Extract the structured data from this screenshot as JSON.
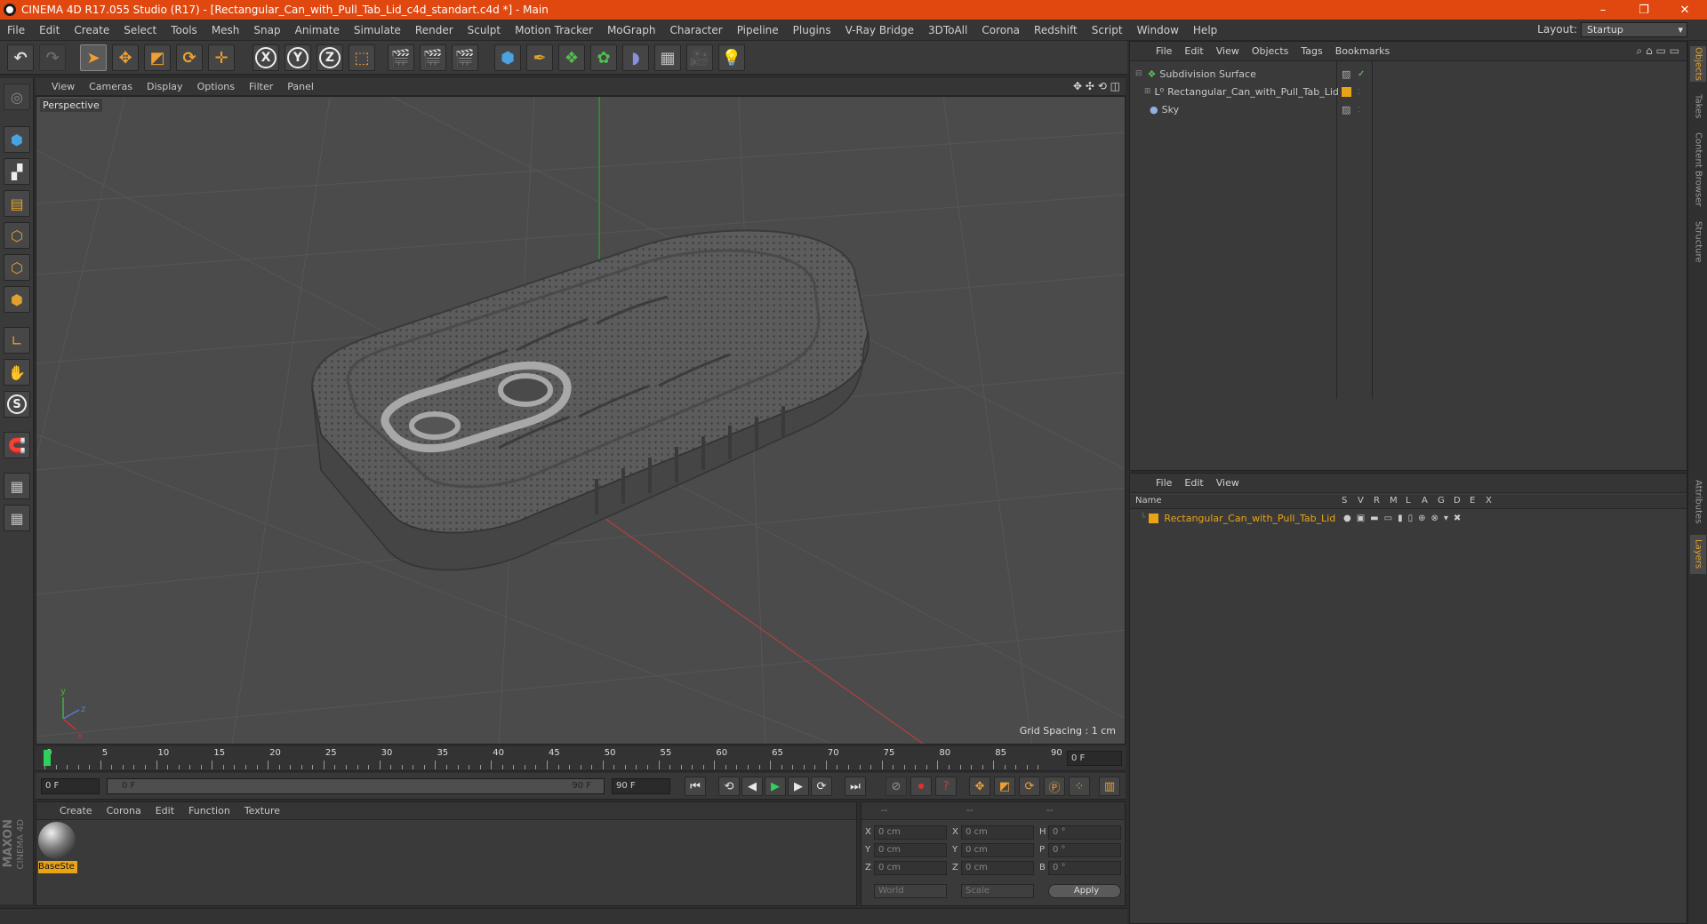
{
  "window": {
    "title": "CINEMA 4D R17.055 Studio (R17) - [Rectangular_Can_with_Pull_Tab_Lid_c4d_standart.c4d *] - Main",
    "minimize": "–",
    "restore": "❐",
    "close": "✕"
  },
  "menu": [
    "File",
    "Edit",
    "Create",
    "Select",
    "Tools",
    "Mesh",
    "Snap",
    "Animate",
    "Simulate",
    "Render",
    "Sculpt",
    "Motion Tracker",
    "MoGraph",
    "Character",
    "Pipeline",
    "Plugins",
    "V-Ray Bridge",
    "3DToAll",
    "Corona",
    "Redshift",
    "Script",
    "Window",
    "Help"
  ],
  "layout": {
    "label": "Layout:",
    "value": "Startup"
  },
  "toolbar": {
    "axis_x": "X",
    "axis_y": "Y",
    "axis_z": "Z"
  },
  "lefttools": {
    "snap_s": "S"
  },
  "viewport": {
    "menu": [
      "View",
      "Cameras",
      "Display",
      "Options",
      "Filter",
      "Panel"
    ],
    "label": "Perspective",
    "grid_spacing": "Grid Spacing : 1 cm",
    "axis_y": "y",
    "axis_z": "z",
    "axis_x": "x"
  },
  "timeline": {
    "ticks": [
      "0",
      "5",
      "10",
      "15",
      "20",
      "25",
      "30",
      "35",
      "40",
      "45",
      "50",
      "55",
      "60",
      "65",
      "70",
      "75",
      "80",
      "85",
      "90"
    ],
    "current_frame": "0 F"
  },
  "transport": {
    "start": "0 F",
    "range_start": "0 F",
    "range_end": "90 F",
    "end": "90 F"
  },
  "material": {
    "menu": [
      "Create",
      "Corona",
      "Edit",
      "Function",
      "Texture"
    ],
    "items": [
      {
        "name": "BaseSte"
      }
    ],
    "brand": "MAXON",
    "brand_sub": "CINEMA 4D"
  },
  "coords": {
    "headers": [
      "--",
      "--",
      "--"
    ],
    "rows": [
      {
        "l1": "X",
        "v1": "0 cm",
        "l2": "X",
        "v2": "0 cm",
        "l3": "H",
        "v3": "0 °"
      },
      {
        "l1": "Y",
        "v1": "0 cm",
        "l2": "Y",
        "v2": "0 cm",
        "l3": "P",
        "v3": "0 °"
      },
      {
        "l1": "Z",
        "v1": "0 cm",
        "l2": "Z",
        "v2": "0 cm",
        "l3": "B",
        "v3": "0 °"
      }
    ],
    "world": "World",
    "scale": "Scale",
    "apply": "Apply"
  },
  "objects": {
    "menu": [
      "File",
      "Edit",
      "View",
      "Objects",
      "Tags",
      "Bookmarks"
    ],
    "rows": [
      {
        "name": "Subdivision Surface"
      },
      {
        "name": "Rectangular_Can_with_Pull_Tab_Lid"
      },
      {
        "name": "Sky"
      }
    ]
  },
  "layers": {
    "menu": [
      "File",
      "Edit",
      "View"
    ],
    "header_name": "Name",
    "columns": [
      "S",
      "V",
      "R",
      "M",
      "L",
      "A",
      "G",
      "D",
      "E",
      "X"
    ],
    "rows": [
      {
        "name": "Rectangular_Can_with_Pull_Tab_Lid",
        "color": "#e8a317"
      }
    ]
  },
  "right_tabs": [
    "Objects",
    "Takes",
    "Content Browser",
    "Structure",
    "Attributes",
    "Layers"
  ],
  "colors": {
    "accent": "#e0480f",
    "layer_orange": "#e8a317",
    "axis_red": "#c83232",
    "axis_green": "#3cb43c"
  }
}
